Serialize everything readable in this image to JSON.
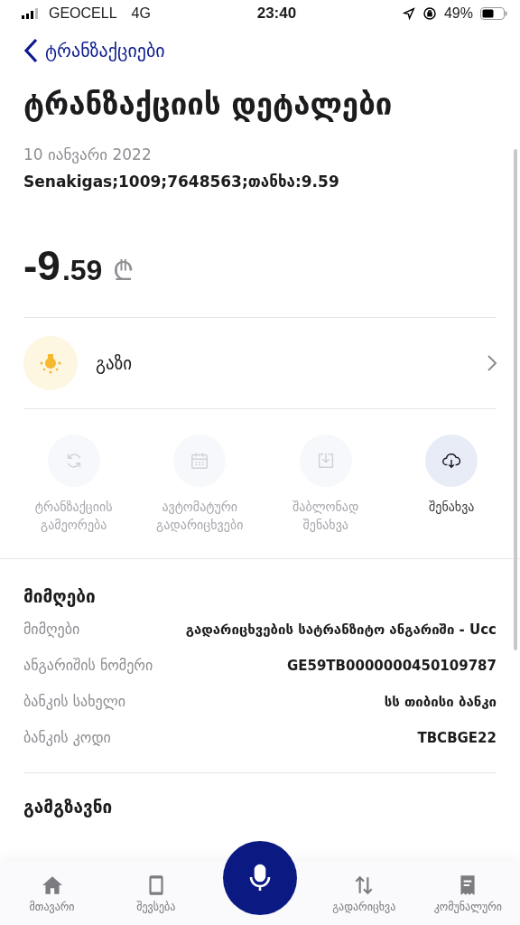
{
  "status_bar": {
    "carrier": "GEOCELL",
    "network": "4G",
    "time": "23:40",
    "battery": "49%"
  },
  "nav": {
    "back_label": "ტრანზაქციები"
  },
  "title": "ტრანზაქციის დეტალები",
  "date": "10 იანვარი 2022",
  "description": "Senakigas;1009;7648563;თანხა:9.59",
  "amount": {
    "whole": "-9",
    "fraction": ".59",
    "currency": "₾"
  },
  "category": {
    "label": "გაზი"
  },
  "actions": [
    {
      "kind": "repeat",
      "label": "ტრანზაქციის გამეორება",
      "disabled": true
    },
    {
      "kind": "calendar",
      "label": "ავტომატური გადარიცხვები",
      "disabled": true
    },
    {
      "kind": "template",
      "label": "შაბლონად შენახვა",
      "disabled": true
    },
    {
      "kind": "download",
      "label": "შენახვა",
      "disabled": false
    }
  ],
  "recipient": {
    "heading": "მიმღები",
    "rows": [
      {
        "label": "მიმღები",
        "value": "გადარიცხვების სატრანზიტო ანგარიში - Ucc"
      },
      {
        "label": "ანგარიშის ნომერი",
        "value": "GE59TB0000000450109787"
      },
      {
        "label": "ბანკის სახელი",
        "value": "სს თიბისი ბანკი"
      },
      {
        "label": "ბანკის კოდი",
        "value": "TBCBGE22"
      }
    ]
  },
  "sender": {
    "heading": "გამგზავნი"
  },
  "tab_bar": [
    {
      "kind": "home",
      "label": "მთავარი"
    },
    {
      "kind": "phone",
      "label": "შევსება"
    },
    {
      "kind": "mic"
    },
    {
      "kind": "transfer",
      "label": "გადარიცხვა"
    },
    {
      "kind": "receipt",
      "label": "კომუნალური"
    }
  ]
}
